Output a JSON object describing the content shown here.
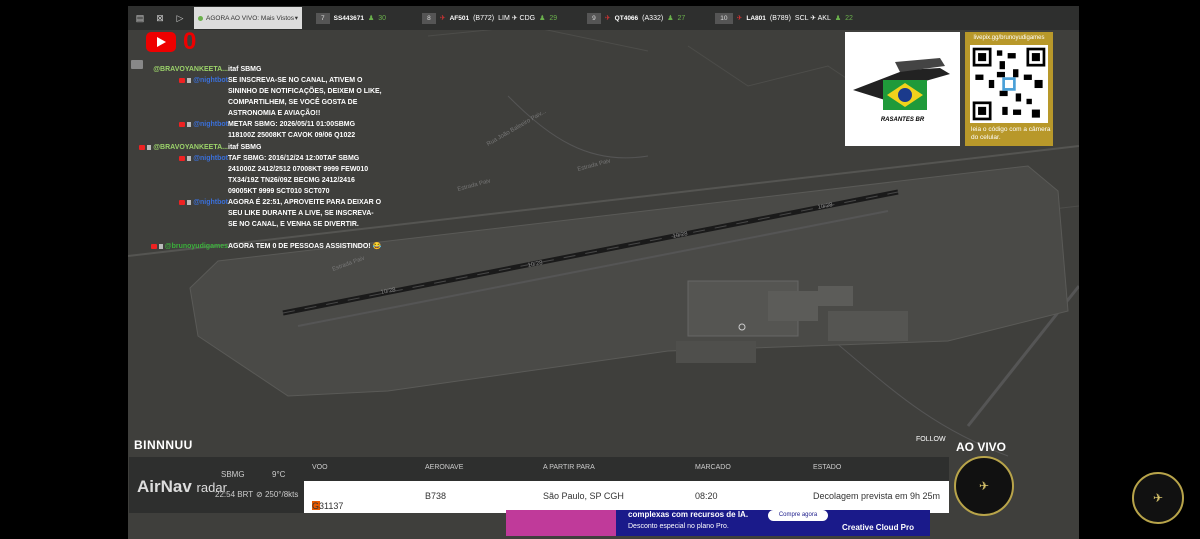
{
  "topbar": {
    "live_label": "AGORA AO VIVO:",
    "live_mode": "Mais Vistos",
    "flights": [
      {
        "num": "7",
        "code": "SS443671",
        "meta": "",
        "route": "",
        "count": "30"
      },
      {
        "num": "8",
        "code": "AF501",
        "meta": "(B772)",
        "route": "LIM ✈ CDG",
        "count": "29"
      },
      {
        "num": "9",
        "code": "QT4066",
        "meta": "(A332)",
        "route": "",
        "count": "27"
      },
      {
        "num": "10",
        "code": "LA801",
        "meta": "(B789)",
        "route": "SCL ✈ AKL",
        "count": "22"
      }
    ]
  },
  "youtube": {
    "count": "0"
  },
  "chat": [
    {
      "user": "@BRAVOYANKEETA...",
      "color": "#9bd26a",
      "text": "itaf SBMG"
    },
    {
      "user": "@nightbot",
      "color": "#3a6fd8",
      "text": "SE INSCREVA-SE NO CANAL, ATIVEM O SININHO DE NOTIFICAÇÕES, DEIXEM O LIKE, COMPARTILHEM, SE VOCÊ GOSTA DE ASTRONOMIA E AVIAÇÃO!!"
    },
    {
      "user": "@nightbot",
      "color": "#3a6fd8",
      "text": "METAR SBMG: 2026/05/11 01:00SBMG 118100Z 25008KT CAVOK 09/06 Q1022"
    },
    {
      "user": "@BRAVOYANKEETA...",
      "color": "#9bd26a",
      "text": "itaf SBMG"
    },
    {
      "user": "@nightbot",
      "color": "#3a6fd8",
      "text": "TAF SBMG: 2016/12/24 12:00TAF SBMG 241000Z 2412/2512 07008KT 9999 FEW010 TX34/19Z TN26/09Z BECMG 2412/2416 09005KT 9999 SCT010 SCT070"
    },
    {
      "user": "@nightbot",
      "color": "#3a6fd8",
      "text": "AGORA É 22:51, APROVEITE PARA DEIXAR O SEU LIKE DURANTE A LIVE, SE INSCREVA-SE NO CANAL, E VENHA SE DIVERTIR."
    },
    {
      "user": "@brunoyudigames",
      "color": "#3bb03b",
      "text": "AGORA TEM 0 DE PESSOAS ASSISTINDO! 😂"
    }
  ],
  "logo": {
    "text": "RASANTES BR"
  },
  "qr": {
    "url": "livepix.gg/brunoyudigames",
    "caption": "leia o código com a câmera do celular."
  },
  "map": {
    "runway_labels": [
      "10/28",
      "10/28",
      "10/28",
      "10/28"
    ],
    "road_labels": [
      "Estrada Paiv",
      "Estrada Paiv",
      "Rua João Baleeiro Paiv...",
      "Estrada Paiv"
    ]
  },
  "bottom": {
    "title": "BINNNUU",
    "follow": "FOLLOW",
    "live": "AO VIVO"
  },
  "airnav": {
    "logo_main": "AirNav",
    "logo_sub": "radar",
    "airport": "SBMG",
    "local_time": "22:54 BRT",
    "temp": "9°C",
    "wind": "250°/8kts",
    "headers": {
      "flight": "VOO",
      "aircraft": "AERONAVE",
      "from": "A PARTIR PARA",
      "scheduled": "MARCADO",
      "status": "ESTADO"
    },
    "row": {
      "flight": "G31137",
      "aircraft": "B738",
      "from": "São Paulo, SP CGH",
      "scheduled": "08:20",
      "status": "Decolagem prevista em 9h 25m"
    }
  },
  "ad": {
    "line1": "complexas com recursos de IA.",
    "line2": "Desconto especial no plano Pro.",
    "button": "Compre agora",
    "product": "Creative Cloud Pro"
  }
}
